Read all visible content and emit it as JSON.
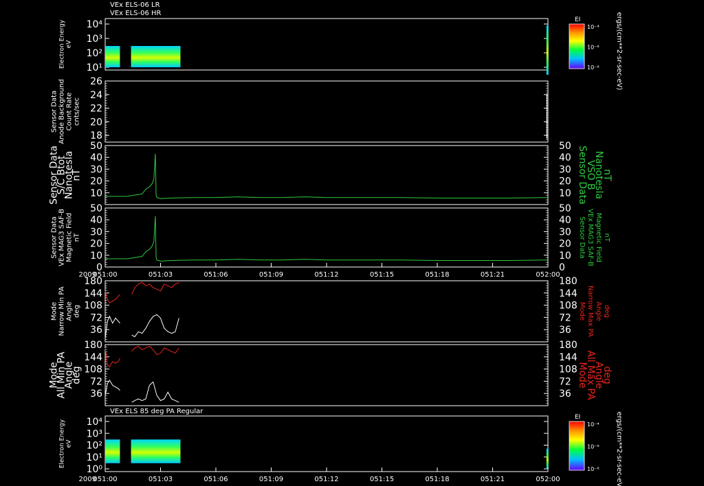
{
  "chart_data": {
    "type": "line",
    "xrange": [
      "051:00",
      "052:00"
    ],
    "xticks": [
      "051:00",
      "051:03",
      "051:06",
      "051:09",
      "051:12",
      "051:15",
      "051:18",
      "051:21",
      "052:00"
    ],
    "year": "2009",
    "panels": [
      {
        "id": "els-lr-hr",
        "type": "heatmap",
        "titles": [
          "VEx ELS-06 LR",
          "VEx ELS-06 HR"
        ],
        "ylabel": [
          "Electron Energy",
          "eV"
        ],
        "yscale": "log",
        "yticks": [
          "10⁴",
          "10³",
          "10²",
          "10¹"
        ],
        "colorbar": {
          "label": "EI",
          "ticks": [
            "10⁻⁴",
            "10⁻⁶",
            "10⁻⁸"
          ],
          "unit": "ergs/(cm**2-sr-sec-eV)"
        },
        "data_blocks": [
          {
            "x": [
              "051:00",
              "051:02"
            ],
            "energy_eV": [
              10,
              300
            ]
          },
          {
            "x": [
              "051:03.5",
              "051:10.2"
            ],
            "energy_eV": [
              10,
              300
            ]
          },
          {
            "x": [
              "051:59.8",
              "052:00"
            ],
            "energy_eV": [
              3,
              8000
            ]
          }
        ]
      },
      {
        "id": "anode-background",
        "type": "line",
        "ylabel": [
          "Sensor Data",
          "Anode Background",
          "Count Rate",
          "cnts/sec"
        ],
        "ylim": [
          17,
          26
        ],
        "yticks": [
          26,
          24,
          22,
          20,
          18
        ],
        "series": [
          {
            "color": "#ffffff",
            "x": [
              "051:59.85",
              "051:59.85"
            ],
            "y": [
              17.5,
              24
            ]
          }
        ]
      },
      {
        "id": "sc-bmag",
        "type": "line",
        "ylabel": [
          "Sensor Data",
          "S/C Btot",
          "Nanotesla",
          "nT"
        ],
        "right_label": [
          "Sensor Data",
          "VSO B",
          "Nanotesla",
          "nT"
        ],
        "ylim": [
          0,
          50
        ],
        "yticks": [
          50,
          40,
          30,
          20,
          10
        ],
        "series": [
          {
            "color": "#2ecc40",
            "x_min": [
              0,
              3,
              5,
              5.5,
              6,
              6.4,
              6.6,
              6.8,
              6.9,
              7,
              7.5,
              9,
              12,
              15,
              18,
              21,
              24,
              27,
              30,
              35,
              40,
              45,
              50,
              55,
              60
            ],
            "y": [
              7,
              7,
              9,
              13,
              15,
              18,
              22,
              43,
              8,
              6,
              5,
              5.5,
              6,
              6,
              6.5,
              6,
              6,
              6.5,
              6,
              6,
              6,
              5.5,
              5.5,
              5.5,
              6
            ]
          }
        ]
      },
      {
        "id": "mag-saf-b",
        "type": "line",
        "ylabel": [
          "Sensor Data",
          "VEx MAG3 SAF-B",
          "Magnetic Field",
          "nT"
        ],
        "right_label": [
          "Sensor Data",
          "VEx MAG3 SAF-B",
          "Magnetic Field",
          "nT"
        ],
        "ylim": [
          0,
          50
        ],
        "yticks": [
          50,
          40,
          30,
          20,
          10,
          0
        ],
        "series": [
          {
            "color": "#2ecc40",
            "x_min": [
              0,
              3,
              5,
              5.5,
              6,
              6.4,
              6.6,
              6.8,
              6.9,
              7,
              7.5,
              9,
              12,
              15,
              18,
              21,
              24,
              27,
              30,
              35,
              40,
              45,
              50,
              55,
              60
            ],
            "y": [
              7,
              7,
              9,
              13,
              15,
              18,
              22,
              43,
              8,
              6,
              5,
              5.5,
              6,
              6,
              6.5,
              6,
              6,
              6.5,
              6,
              6,
              6,
              5.5,
              5.5,
              5.5,
              6
            ]
          }
        ]
      },
      {
        "id": "narrow-pa",
        "type": "line",
        "ylabel": [
          "Mode",
          "Narrow Min PA",
          "Angle",
          "deg"
        ],
        "right_label": [
          "Mode",
          "Narrow Max PA",
          "Angle",
          "deg"
        ],
        "ylim": [
          0,
          180
        ],
        "yticks": [
          180,
          144,
          108,
          72,
          36
        ],
        "series": [
          {
            "color": "#ffffff",
            "x_min": [
              0,
              0.3,
              0.6,
              1,
              1.4,
              1.8,
              2
            ],
            "y": [
              10,
              60,
              75,
              55,
              70,
              60,
              55
            ]
          },
          {
            "color": "#e8251e",
            "x_min": [
              0,
              0.3,
              0.6,
              1,
              1.4,
              1.8,
              2
            ],
            "y": [
              150,
              125,
              115,
              120,
              125,
              135,
              140
            ]
          },
          {
            "color": "#ffffff",
            "x_min": [
              3.6,
              4,
              4.5,
              5,
              5.5,
              6,
              6.5,
              7,
              7.5,
              8,
              8.5,
              9,
              9.5,
              10
            ],
            "y": [
              20,
              15,
              30,
              25,
              40,
              60,
              75,
              80,
              70,
              40,
              30,
              25,
              30,
              70
            ]
          },
          {
            "color": "#e8251e",
            "x_min": [
              3.6,
              4,
              4.5,
              5,
              5.5,
              6,
              6.5,
              7,
              7.5,
              8,
              8.5,
              9,
              9.5,
              10
            ],
            "y": [
              140,
              160,
              170,
              175,
              165,
              170,
              160,
              155,
              150,
              170,
              165,
              160,
              170,
              175
            ]
          }
        ]
      },
      {
        "id": "all-pa",
        "type": "line",
        "ylabel": [
          "Mode",
          "All Min PA",
          "Angle",
          "deg"
        ],
        "right_label": [
          "Mode",
          "All Max PA",
          "Angle",
          "deg"
        ],
        "ylim": [
          0,
          180
        ],
        "yticks": [
          180,
          144,
          108,
          72,
          36
        ],
        "series": [
          {
            "color": "#ffffff",
            "x_min": [
              0,
              0.3,
              0.6,
              1,
              1.4,
              1.8,
              2
            ],
            "y": [
              30,
              65,
              75,
              60,
              55,
              50,
              45
            ]
          },
          {
            "color": "#e8251e",
            "x_min": [
              0,
              0.3,
              0.6,
              1,
              1.4,
              1.8,
              2
            ],
            "y": [
              170,
              120,
              115,
              130,
              125,
              130,
              140
            ]
          },
          {
            "color": "#ffffff",
            "x_min": [
              3.6,
              4,
              4.5,
              5,
              5.5,
              6,
              6.5,
              7,
              7.5,
              8,
              8.5,
              9,
              9.5,
              10
            ],
            "y": [
              10,
              15,
              20,
              15,
              20,
              60,
              70,
              30,
              15,
              20,
              40,
              20,
              15,
              10
            ]
          },
          {
            "color": "#e8251e",
            "x_min": [
              3.6,
              4,
              4.5,
              5,
              5.5,
              6,
              6.5,
              7,
              7.5,
              8,
              8.5,
              9,
              9.5,
              10
            ],
            "y": [
              160,
              170,
              175,
              165,
              170,
              175,
              165,
              150,
              155,
              170,
              165,
              160,
              155,
              170
            ]
          }
        ]
      },
      {
        "id": "els-85deg",
        "type": "heatmap",
        "titles": [
          "VEx ELS 85 deg PA Regular"
        ],
        "ylabel": [
          "Electron Energy",
          "eV"
        ],
        "yscale": "log",
        "yticks": [
          "10⁴",
          "10³",
          "10²",
          "10¹",
          "10⁰"
        ],
        "colorbar": {
          "label": "EI",
          "ticks": [
            "10⁻⁴",
            "10⁻⁶",
            "10⁻⁸"
          ],
          "unit": "ergs/(cm**2-sr-sec-eV)"
        },
        "data_blocks": [
          {
            "x": [
              "051:00",
              "051:02"
            ],
            "energy_eV": [
              3,
              300
            ]
          },
          {
            "x": [
              "051:03.5",
              "051:10.2"
            ],
            "energy_eV": [
              3,
              300
            ]
          },
          {
            "x": [
              "051:59.8",
              "052:00"
            ],
            "energy_eV": [
              1,
              50
            ]
          }
        ]
      }
    ]
  }
}
